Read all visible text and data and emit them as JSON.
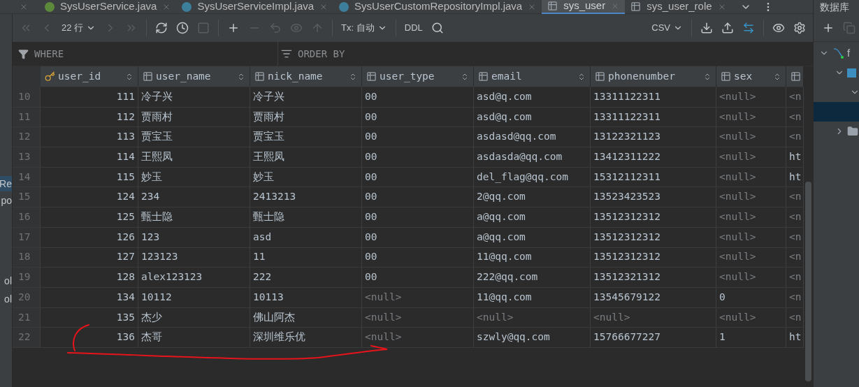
{
  "tabs": [
    {
      "label": "SysUserService.java",
      "kind": "interface",
      "selected": false
    },
    {
      "label": "SysUserServiceImpl.java",
      "kind": "class",
      "selected": false
    },
    {
      "label": "SysUserCustomRepositoryImpl.java",
      "kind": "class",
      "selected": false
    },
    {
      "label": "sys_user",
      "kind": "table",
      "selected": true
    },
    {
      "label": "sys_user_role",
      "kind": "table",
      "selected": false
    }
  ],
  "toolbar": {
    "row_count": "22 行",
    "transaction": "Tx: 自动",
    "ddl": "DDL",
    "export_format": "CSV"
  },
  "filter": {
    "where": "WHERE",
    "order_by": "ORDER BY"
  },
  "left_panel": {
    "items": [
      {
        "label": "Re",
        "selected": true
      },
      {
        "label": "po",
        "selected": false
      },
      {
        "label": "ol",
        "selected": false
      },
      {
        "label": "ol",
        "selected": false
      }
    ]
  },
  "table": {
    "columns": [
      {
        "label": "user_id",
        "kind": "primary_key"
      },
      {
        "label": "user_name",
        "kind": "column"
      },
      {
        "label": "nick_name",
        "kind": "column"
      },
      {
        "label": "user_type",
        "kind": "column"
      },
      {
        "label": "email",
        "kind": "column"
      },
      {
        "label": "phonenumber",
        "kind": "column"
      },
      {
        "label": "sex",
        "kind": "column"
      },
      {
        "kind": "column"
      }
    ],
    "rows": [
      {
        "number": "10",
        "cells": [
          "111",
          "冷子兴",
          "冷子兴",
          "00",
          "asd@q.com",
          "13311122311",
          {
            "text": "<null>",
            "kind": "null"
          },
          {
            "text": "<n",
            "kind": "null"
          }
        ]
      },
      {
        "number": "11",
        "cells": [
          "112",
          "贾雨村",
          "贾雨村",
          "00",
          "asd@q.com",
          "13311122311",
          {
            "text": "<null>",
            "kind": "null"
          },
          {
            "text": "<n",
            "kind": "null"
          }
        ]
      },
      {
        "number": "12",
        "cells": [
          "113",
          "贾宝玉",
          "贾宝玉",
          "00",
          "asdasd@qq.com",
          "13122321123",
          {
            "text": "<null>",
            "kind": "null"
          },
          {
            "text": "<n",
            "kind": "null"
          }
        ]
      },
      {
        "number": "13",
        "cells": [
          "114",
          "王熙凤",
          "王熙凤",
          "00",
          "asdasda@qq.com",
          "13412311222",
          {
            "text": "<null>",
            "kind": "null"
          },
          "ht"
        ]
      },
      {
        "number": "14",
        "cells": [
          "115",
          "妙玉",
          "妙玉",
          "00",
          "del_flag@qq.com",
          "15312112311",
          {
            "text": "<null>",
            "kind": "null"
          },
          "ht"
        ]
      },
      {
        "number": "15",
        "cells": [
          "124",
          "234",
          "2413213",
          "00",
          "2@qq.com",
          "13523423523",
          {
            "text": "<null>",
            "kind": "null"
          },
          {
            "text": "<n",
            "kind": "null"
          }
        ]
      },
      {
        "number": "16",
        "cells": [
          "125",
          "甄士隐",
          "甄士隐",
          "00",
          "a@qq.com",
          "13512312312",
          {
            "text": "<null>",
            "kind": "null"
          },
          {
            "text": "<n",
            "kind": "null"
          }
        ]
      },
      {
        "number": "17",
        "cells": [
          "126",
          "123",
          "asd",
          "00",
          "a@qq.com",
          "13512312312",
          {
            "text": "<null>",
            "kind": "null"
          },
          {
            "text": "<n",
            "kind": "null"
          }
        ]
      },
      {
        "number": "18",
        "cells": [
          "127",
          "123123",
          "11",
          "00",
          "11@qq.com",
          "13512312312",
          {
            "text": "<null>",
            "kind": "null"
          },
          {
            "text": "<n",
            "kind": "null"
          }
        ]
      },
      {
        "number": "19",
        "cells": [
          "128",
          "alex123123",
          "222",
          "00",
          "222@qq.com",
          "13512321312",
          {
            "text": "<null>",
            "kind": "null"
          },
          {
            "text": "<n",
            "kind": "null"
          }
        ]
      },
      {
        "number": "20",
        "cells": [
          "134",
          "10112",
          "10113",
          {
            "text": "<null>",
            "kind": "null"
          },
          "11@qq.com",
          "13545679122",
          "0",
          {
            "text": "<n",
            "kind": "null"
          }
        ]
      },
      {
        "number": "21",
        "cells": [
          "135",
          "杰少",
          "佛山阿杰",
          {
            "text": "<null>",
            "kind": "null"
          },
          {
            "text": "<null>",
            "kind": "null"
          },
          {
            "text": "<null>",
            "kind": "null"
          },
          {
            "text": "<null>",
            "kind": "null"
          },
          {
            "text": "<n",
            "kind": "null"
          }
        ]
      },
      {
        "number": "22",
        "cells": [
          "136",
          "杰哥",
          "深圳维乐优",
          {
            "text": "<null>",
            "kind": "null"
          },
          "szwly@qq.com",
          "15766677227",
          "1",
          "ht"
        ]
      }
    ]
  },
  "database_panel": {
    "title": "数据库",
    "tree": [
      {
        "label": "f",
        "kind": "datasource",
        "expanded": true,
        "children": [
          {
            "kind": "schema",
            "expanded": true,
            "children": [
              {
                "expanded": true,
                "children": [
                  {
                    "selected": true
                  }
                ]
              }
            ]
          },
          {
            "kind": "folder",
            "expanded": false
          }
        ]
      }
    ]
  }
}
